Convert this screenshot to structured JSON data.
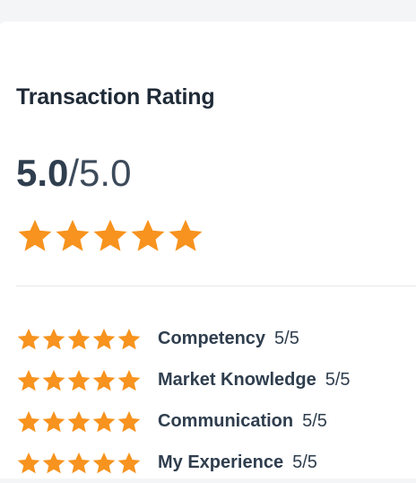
{
  "card": {
    "title": "Transaction Rating",
    "overall_score": "5.0",
    "overall_max": "/5.0",
    "overall_stars": 5,
    "star_color": "#f7931e"
  },
  "categories": [
    {
      "label": "Competency",
      "score": "5/5",
      "stars": 5
    },
    {
      "label": "Market Knowledge",
      "score": "5/5",
      "stars": 5
    },
    {
      "label": "Communication",
      "score": "5/5",
      "stars": 5
    },
    {
      "label": "My Experience",
      "score": "5/5",
      "stars": 5
    }
  ]
}
